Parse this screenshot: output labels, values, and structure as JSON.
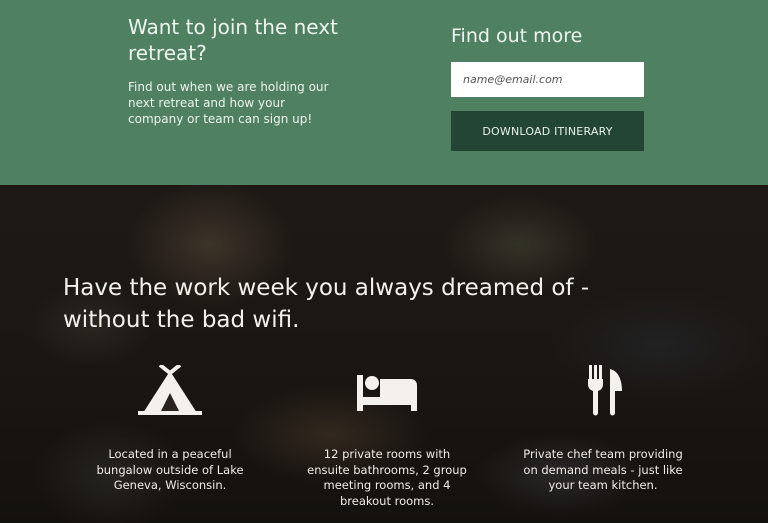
{
  "signup": {
    "title": "Want to join the next retreat?",
    "body": "Find out when we are holding our next retreat and how your company or team can sign up!",
    "find_title": "Find out more",
    "email_placeholder": "name@email.com",
    "button_label": "DOWNLOAD ITINERARY"
  },
  "hero": {
    "title": "Have the work week you always dreamed of - without the bad wifi.",
    "features": [
      {
        "icon": "tent-icon",
        "text": "Located in a peaceful bungalow outside of Lake Geneva, Wisconsin."
      },
      {
        "icon": "bed-icon",
        "text": "12 private rooms with ensuite bathrooms, 2 group meeting rooms, and 4 breakout rooms."
      },
      {
        "icon": "fork-knife-icon",
        "text": "Private chef team providing on demand meals - just like your team kitchen."
      }
    ]
  },
  "colors": {
    "band_green": "#4e8061",
    "button_dark_green": "#234534",
    "hero_dark": "#231d18"
  }
}
